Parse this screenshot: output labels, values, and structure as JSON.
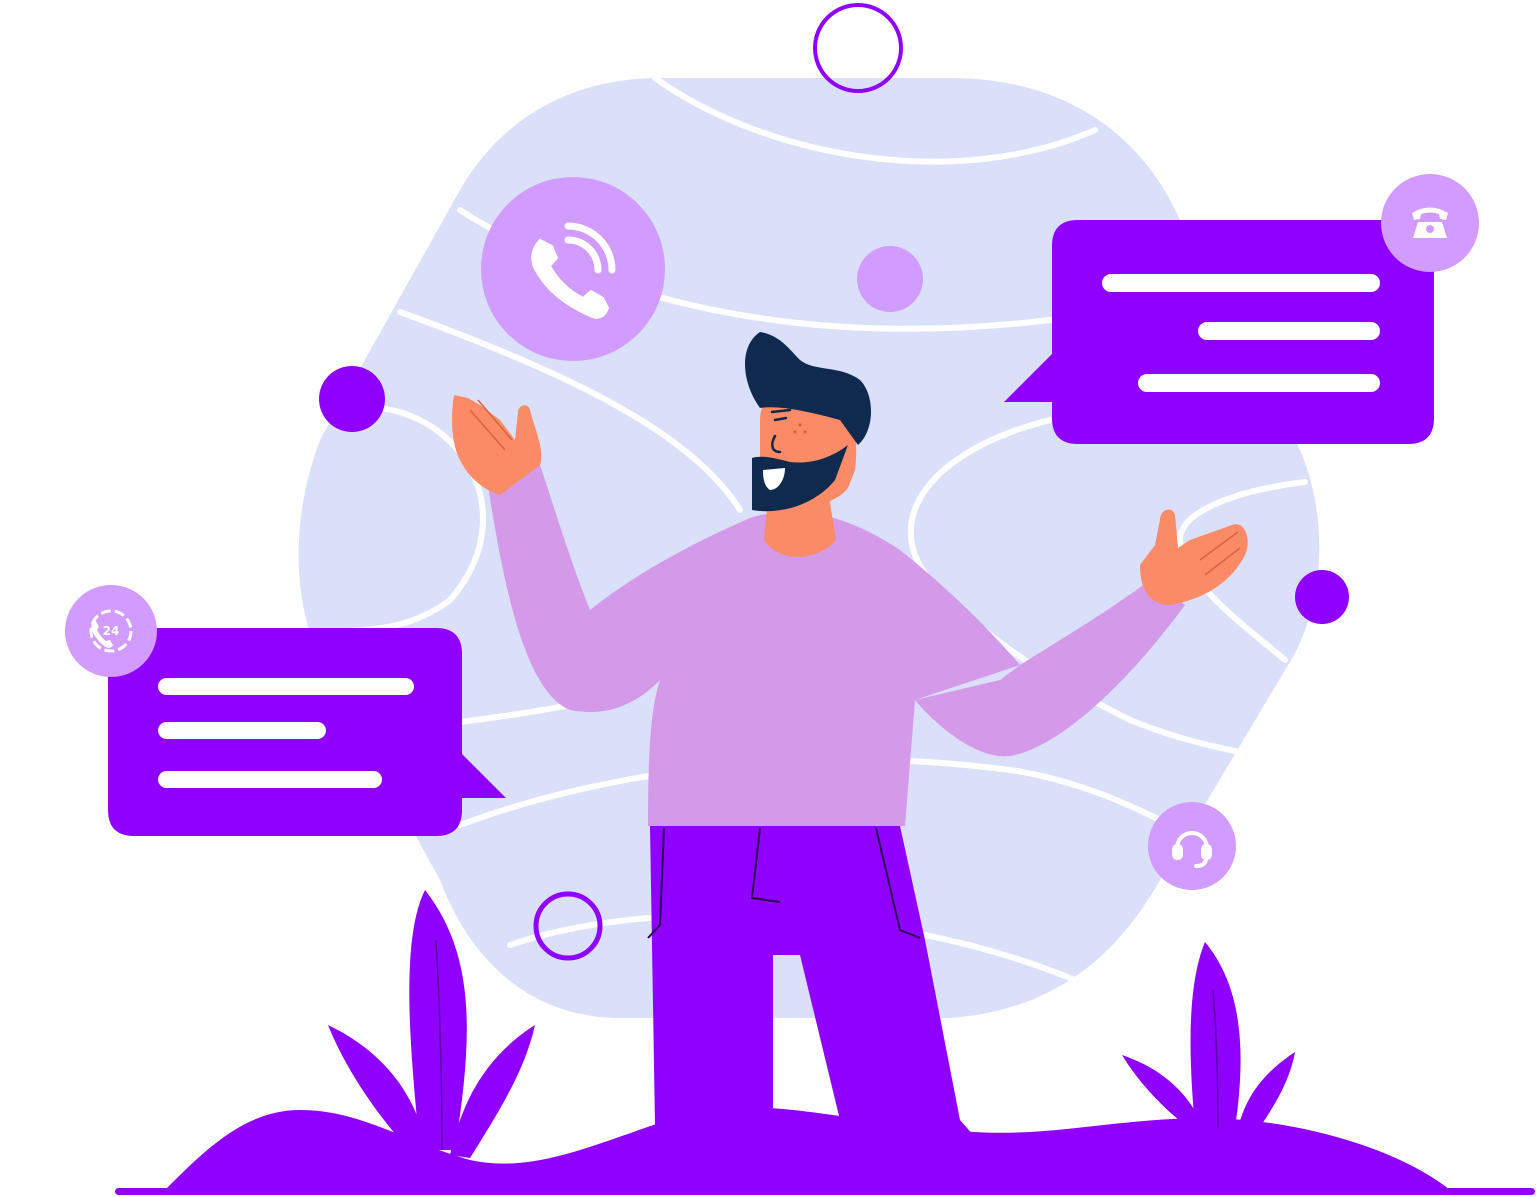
{
  "illustration": {
    "theme": "customer-support-call",
    "colors": {
      "primary": "#8f00ff",
      "light_purple": "#d29bff",
      "shirt": "#d599ea",
      "blob": "#dae0f9",
      "skin": "#fa8b66",
      "hair": "#0f2a4e",
      "white": "#ffffff"
    },
    "badges": {
      "support_24h_text": "24"
    },
    "icons": [
      "phone-ringing-icon",
      "telephone-icon",
      "phone-24h-icon",
      "headset-icon"
    ]
  }
}
